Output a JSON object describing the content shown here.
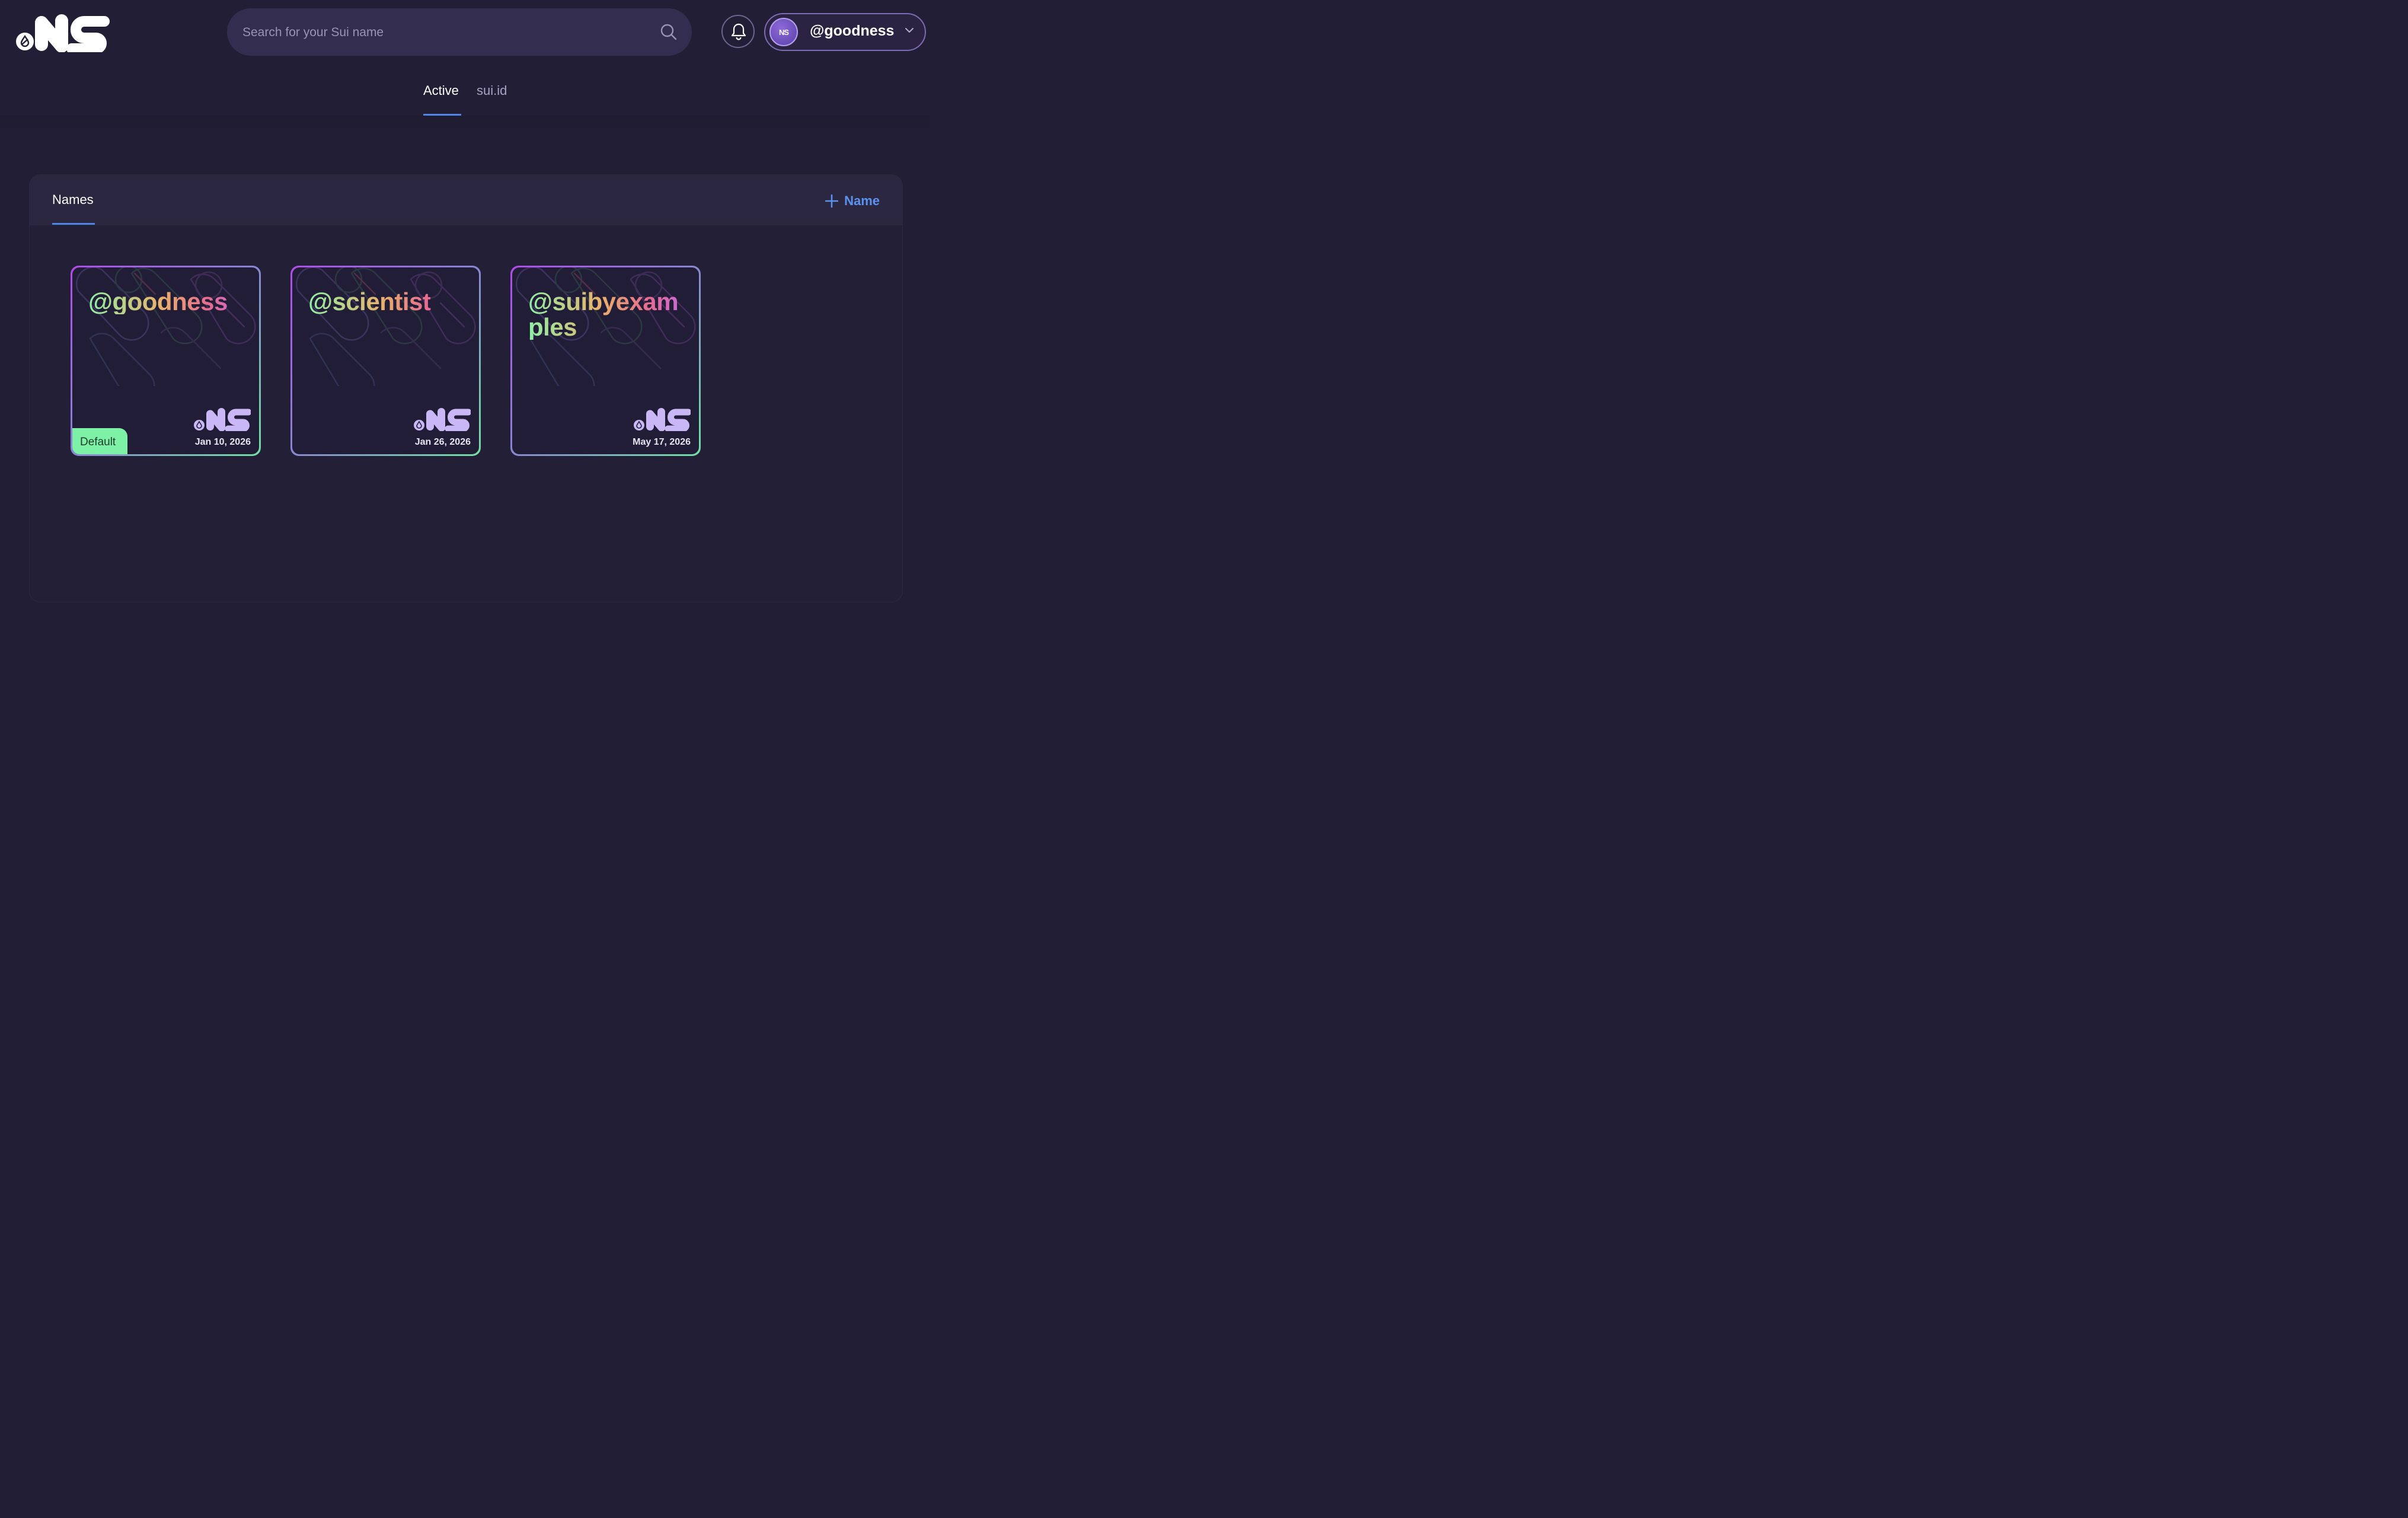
{
  "header": {
    "brand": "NS",
    "search_placeholder": "Search for your Sui name",
    "account_name": "@goodness"
  },
  "tabs": [
    {
      "label": "Active"
    },
    {
      "label": "sui.id"
    }
  ],
  "panel": {
    "title": "Names",
    "add_label": "Name"
  },
  "cards": [
    {
      "name": "@goodness",
      "date": "Jan 10, 2026",
      "badge": "Default"
    },
    {
      "name": "@scientist",
      "date": "Jan 26, 2026"
    },
    {
      "name": "@suibyexamples",
      "date": "May 17, 2026"
    }
  ],
  "colors": {
    "background": "#221e35",
    "accent": "#4f86e8",
    "default_badge": "#7df2a7"
  }
}
